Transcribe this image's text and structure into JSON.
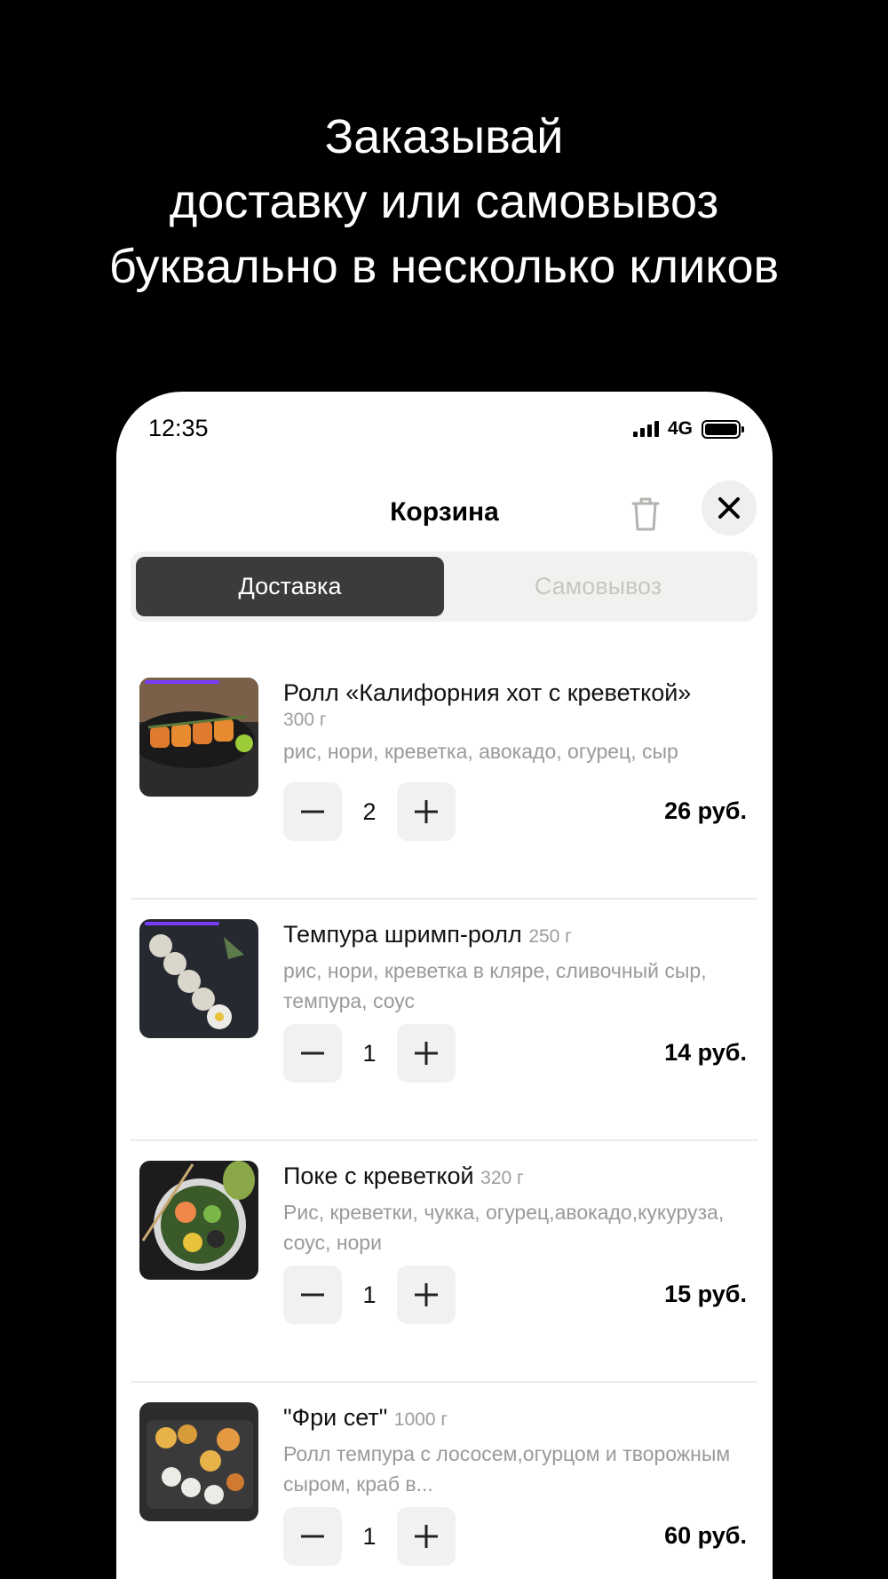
{
  "headline": {
    "line1": "Заказывай",
    "line2": "доставку или самовывоз",
    "line3": "буквально в несколько кликов"
  },
  "status_bar": {
    "time": "12:35",
    "network": "4G"
  },
  "cart": {
    "title": "Корзина",
    "tabs": [
      {
        "label": "Доставка",
        "active": true
      },
      {
        "label": "Самовывоз",
        "active": false
      }
    ],
    "items": [
      {
        "name": "Ролл «Калифорния хот с креветкой»",
        "weight": "300 г",
        "description": "рис, нори, креветка, авокадо, огурец, сыр",
        "quantity": "2",
        "price": "26 руб."
      },
      {
        "name": "Темпура шримп-ролл",
        "weight": "250 г",
        "description": "рис, нори, креветка в кляре, сливочный сыр, темпура, соус",
        "quantity": "1",
        "price": "14 руб."
      },
      {
        "name": "Поке с креветкой",
        "weight": "320 г",
        "description": "Рис, креветки, чукка, огурец,авокадо,кукуруза, соус, нори",
        "quantity": "1",
        "price": "15 руб."
      },
      {
        "name": "\"Фри сет\"",
        "weight": "1000 г",
        "description": "Ролл темпура с лососем,огурцом и творожным сыром, краб в...",
        "quantity": "1",
        "price": "60 руб."
      }
    ]
  },
  "icons": {
    "trash": "trash-icon",
    "close": "close-icon",
    "minus": "minus-icon",
    "plus": "plus-icon"
  },
  "colors": {
    "accent_bar": "#7b3bff",
    "active_tab": "#3b3b3b",
    "button_bg": "#f2f1ef"
  }
}
